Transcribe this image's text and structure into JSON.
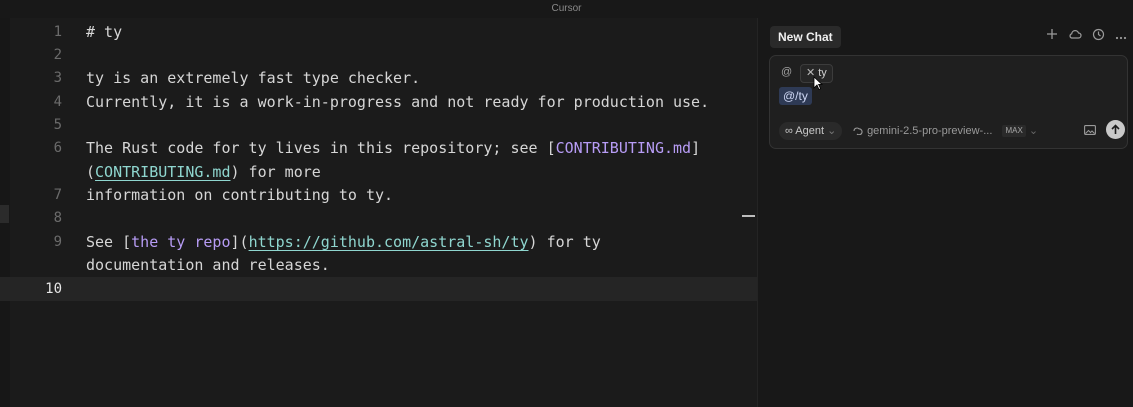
{
  "window": {
    "title": "Cursor"
  },
  "editor": {
    "current_line": "10",
    "lines": [
      {
        "num": "1",
        "text": "# ty"
      },
      {
        "num": "2",
        "text": ""
      },
      {
        "num": "3",
        "text": "ty is an extremely fast type checker."
      },
      {
        "num": "4",
        "text": "Currently, it is a work-in-progress and not ready for production use."
      },
      {
        "num": "5",
        "text": ""
      },
      {
        "num": "6",
        "pre": "The Rust code for ty lives in this repository; see [",
        "link_text": "CONTRIBUTING.md",
        "post": "]"
      },
      {
        "num": "",
        "pre": "(",
        "link_url": "CONTRIBUTING.md",
        "post": ") for more"
      },
      {
        "num": "7",
        "text": "information on contributing to ty."
      },
      {
        "num": "8",
        "text": ""
      },
      {
        "num": "9",
        "pre": "See [",
        "link_text": "the ty repo",
        "mid": "](",
        "link_url": "https://github.com/astral-sh/ty",
        "post": ") for ty"
      },
      {
        "num": "",
        "text": "documentation and releases."
      },
      {
        "num": "10",
        "text": ""
      }
    ]
  },
  "chat": {
    "tab_label": "New Chat",
    "icons": [
      "plus-icon",
      "cloud-icon",
      "history-icon",
      "more-icon"
    ],
    "context_chip": "ty",
    "mention": "@/ty",
    "mode": "Agent",
    "model": "gemini-2.5-pro-preview-...",
    "max_badge": "MAX"
  },
  "colors": {
    "link_text": "#b79cf5",
    "link_url": "#8fd6cf",
    "mention_bg": "#2e3a55"
  }
}
